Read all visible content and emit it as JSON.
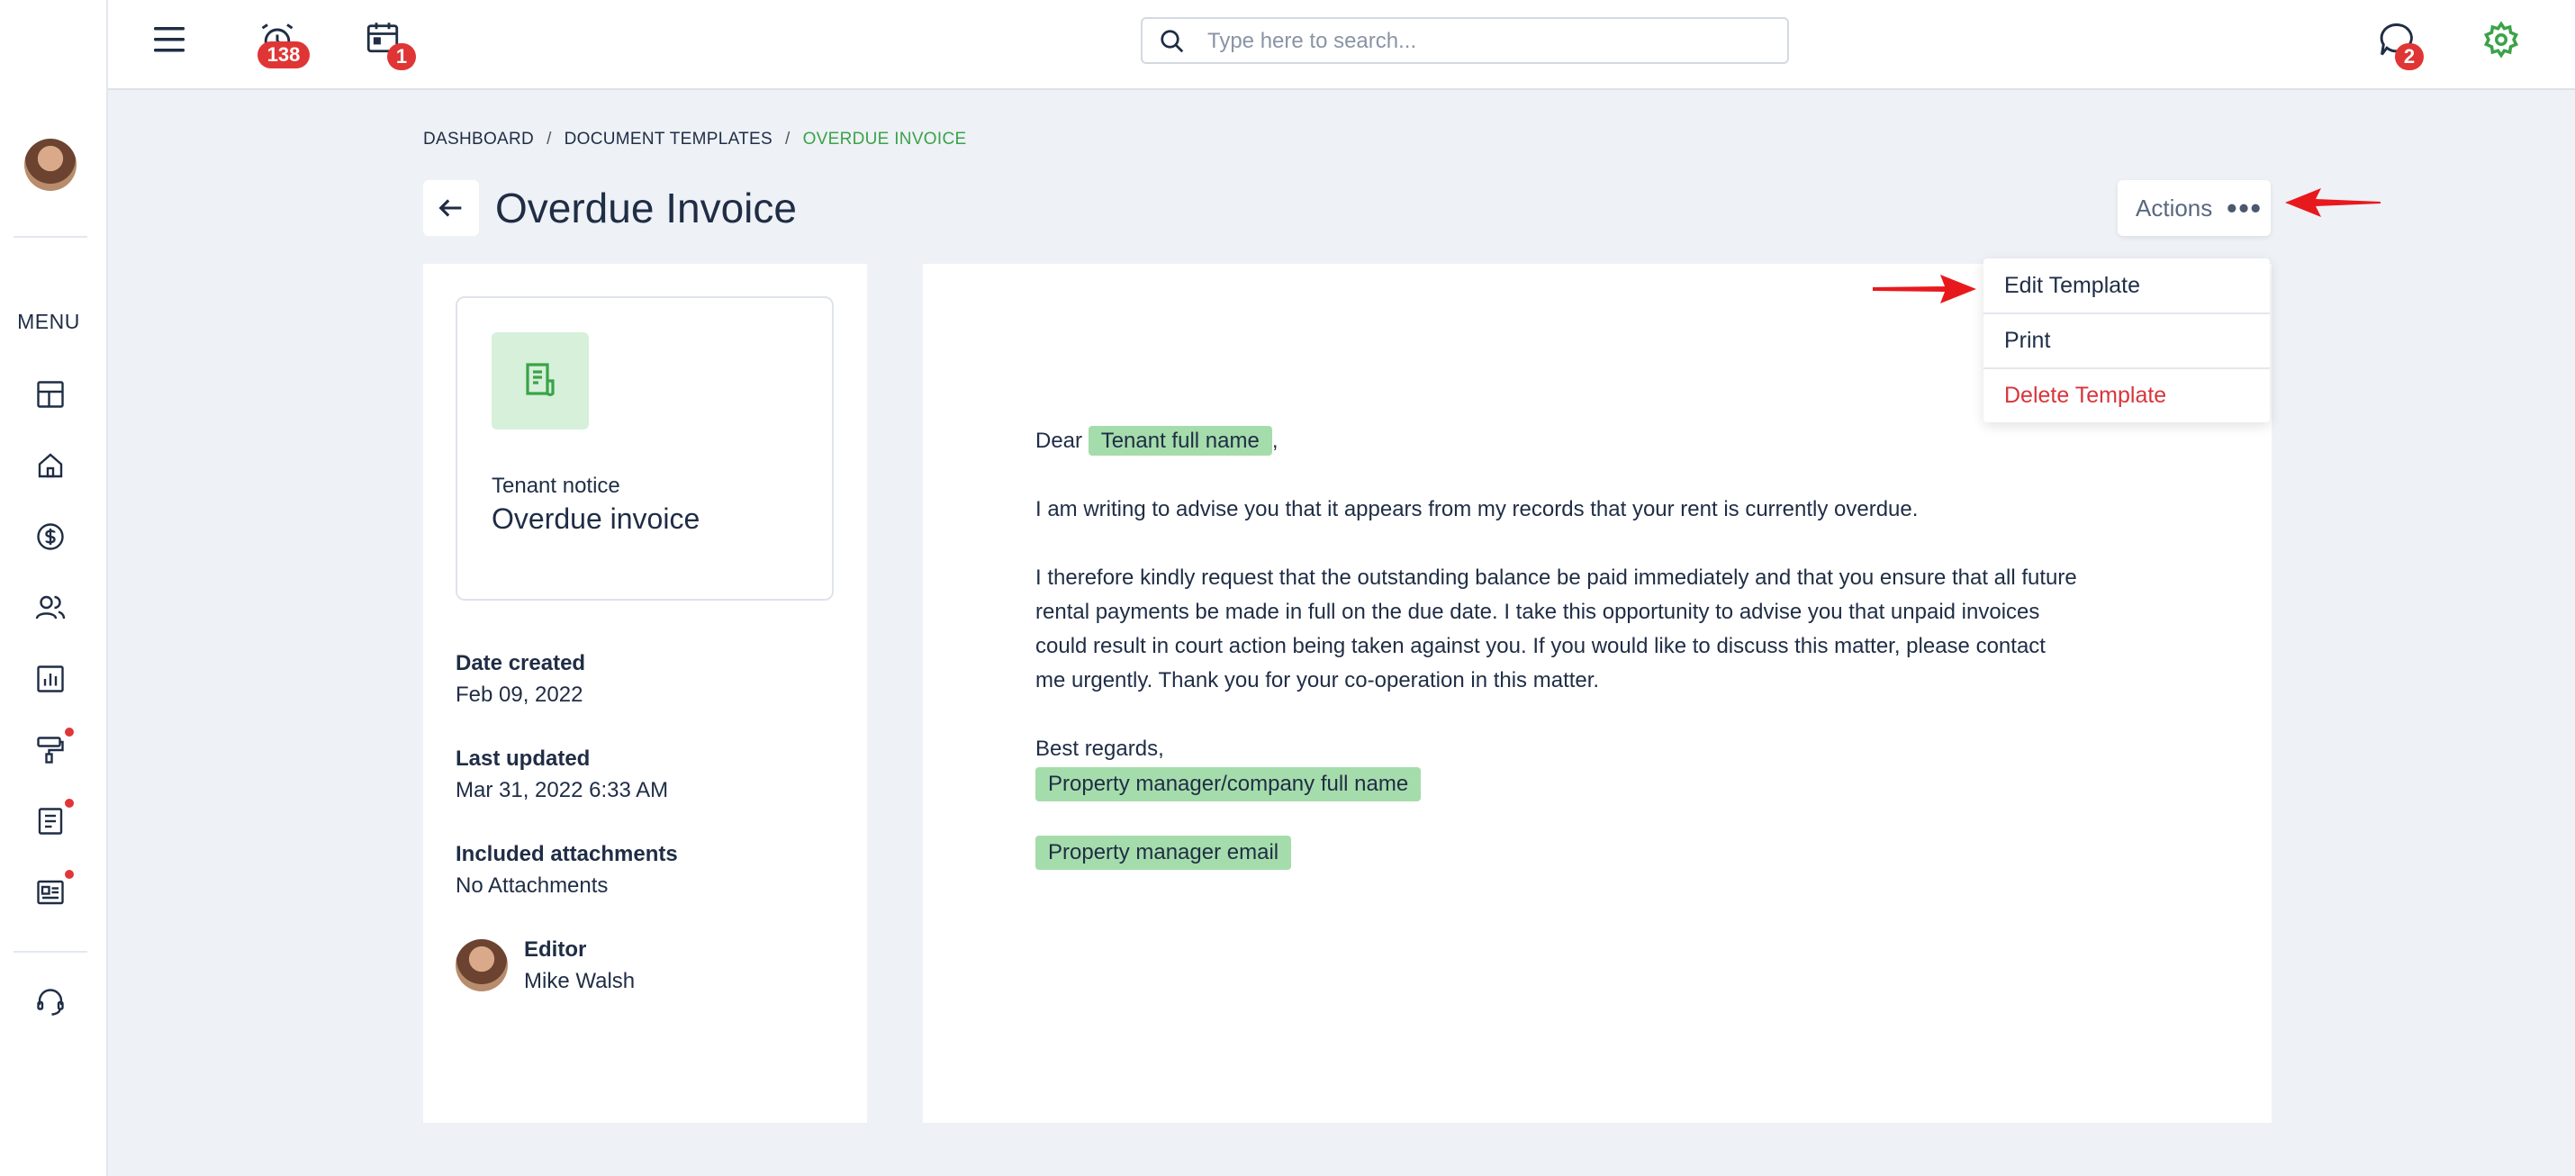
{
  "topbar": {
    "alarm_count": "138",
    "calendar_count": "1",
    "messages_count": "2",
    "search_placeholder": "Type here to search..."
  },
  "sidebar": {
    "menu_label": "MENU",
    "items": [
      "dashboard-icon",
      "home-icon",
      "dollar-icon",
      "users-icon",
      "reports-icon",
      "maintenance-icon",
      "document-icon",
      "listing-icon",
      "support-icon"
    ]
  },
  "breadcrumb": {
    "items": [
      "DASHBOARD",
      "DOCUMENT TEMPLATES",
      "OVERDUE INVOICE"
    ]
  },
  "page": {
    "title": "Overdue Invoice",
    "actions_label": "Actions",
    "actions_dots": "•••"
  },
  "actions_menu": {
    "edit": "Edit Template",
    "print": "Print",
    "delete": "Delete Template"
  },
  "template": {
    "kind": "Tenant notice",
    "name": "Overdue invoice",
    "date_created_label": "Date created",
    "date_created": "Feb 09, 2022",
    "last_updated_label": "Last updated",
    "last_updated": "Mar 31, 2022 6:33 AM",
    "attachments_label": "Included attachments",
    "attachments": "No Attachments",
    "editor_label": "Editor",
    "editor_name": "Mike Walsh"
  },
  "document": {
    "greeting": "Dear",
    "tenant_chip": "Tenant full name",
    "greeting_comma": ",",
    "para1": "I am writing to advise you that it appears from my records that your rent is currently overdue.",
    "para2_line1": "I therefore kindly request that the outstanding balance be paid immediately and that you ensure that all future",
    "para2_line2": "rental payments be made in full on the due date. I take this opportunity to advise you that unpaid invoices",
    "para2_line3": "could result in court action being taken against you. If you would like to discuss this matter, please contact",
    "para2_line4": "me urgently. Thank you for your co-operation in this matter.",
    "signoff": "Best regards,",
    "manager_chip": "Property manager/company full name",
    "email_chip": "Property manager email"
  },
  "colors": {
    "accent_green": "#3aa348",
    "chip_green": "#a5dcab",
    "badge_red": "#e03535",
    "danger_red": "#d9343b",
    "annotation_arrow": "#e8191d"
  }
}
